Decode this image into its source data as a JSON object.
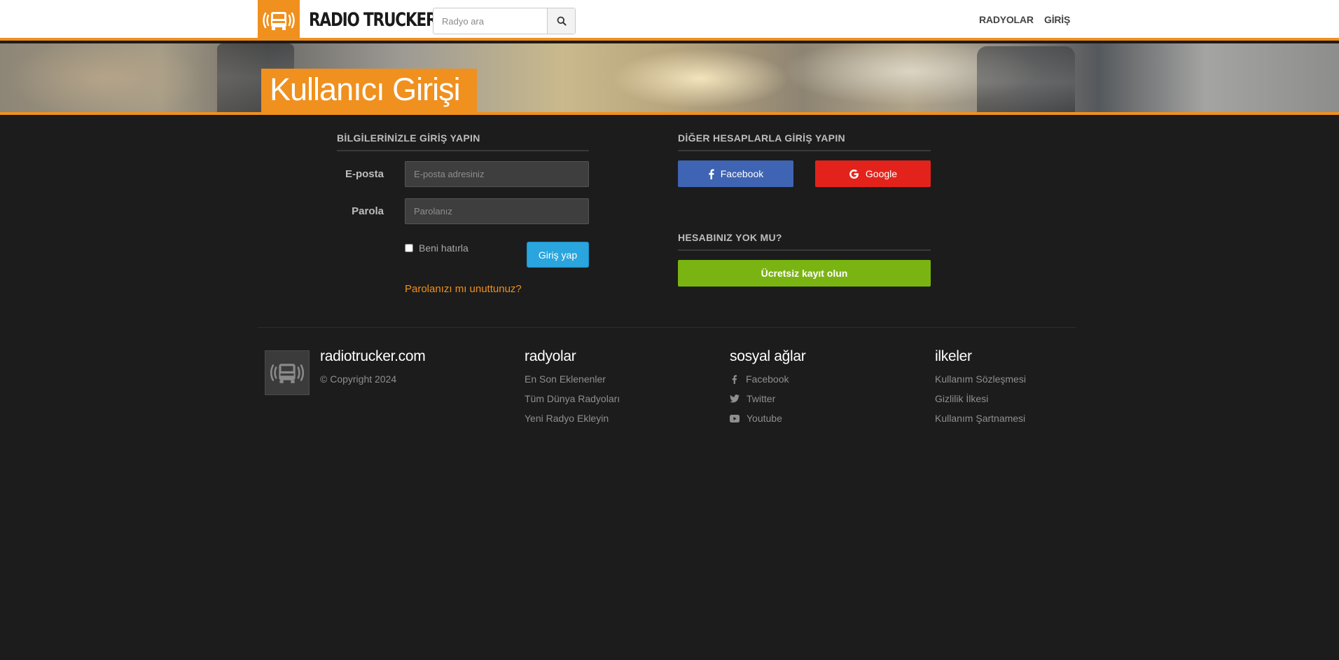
{
  "header": {
    "logo_text": "RADIO TRUCKER",
    "search_placeholder": "Radyo ara",
    "nav": [
      "RADYOLAR",
      "GİRİŞ"
    ]
  },
  "banner": {
    "title": "Kullanıcı Girişi"
  },
  "login": {
    "heading": "BİLGİLERİNİZLE GİRİŞ YAPIN",
    "email_label": "E-posta",
    "email_placeholder": "E-posta adresiniz",
    "password_label": "Parola",
    "password_placeholder": "Parolanız",
    "remember_label": "Beni hatırla",
    "submit_label": "Giriş yap",
    "forgot_label": "Parolanızı mı unuttunuz?"
  },
  "social": {
    "heading": "DİĞER HESAPLARLA GİRİŞ YAPIN",
    "facebook_label": "Facebook",
    "google_label": "Google",
    "noaccount_heading": "HESABINIZ YOK MU?",
    "register_label": "Ücretsiz kayıt olun"
  },
  "footer": {
    "site": {
      "title": "radiotrucker.com",
      "copyright": "© Copyright 2024"
    },
    "radyolar": {
      "title": "radyolar",
      "items": [
        "En Son Eklenenler",
        "Tüm Dünya Radyoları",
        "Yeni Radyo Ekleyin"
      ]
    },
    "social": {
      "title": "sosyal ağlar",
      "items": [
        "Facebook",
        "Twitter",
        "Youtube"
      ]
    },
    "policies": {
      "title": "ilkeler",
      "items": [
        "Kullanım Sözleşmesi",
        "Gizlilik İlkesi",
        "Kullanım Şartnamesi"
      ]
    }
  },
  "colors": {
    "accent": "#f0901e",
    "background": "#1c1c1c",
    "login_button": "#2aa5dd",
    "facebook": "#3f64b3",
    "google": "#e3231b",
    "register": "#7ab412"
  },
  "icons": [
    "truck-radio-icon",
    "search-icon",
    "facebook-icon",
    "google-icon",
    "twitter-icon",
    "youtube-icon"
  ]
}
